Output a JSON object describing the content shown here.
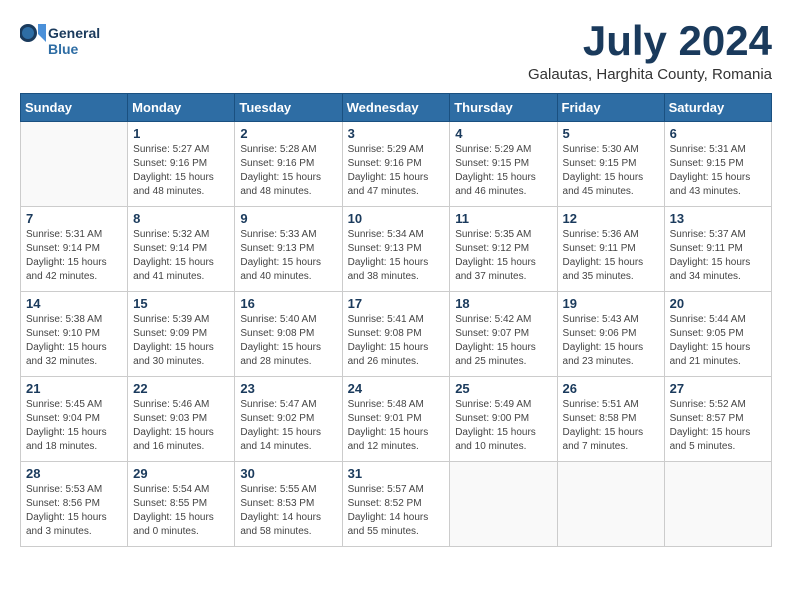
{
  "header": {
    "logo_line1": "General",
    "logo_line2": "Blue",
    "month_year": "July 2024",
    "location": "Galautas, Harghita County, Romania"
  },
  "days_of_week": [
    "Sunday",
    "Monday",
    "Tuesday",
    "Wednesday",
    "Thursday",
    "Friday",
    "Saturday"
  ],
  "weeks": [
    [
      {
        "day": "",
        "info": ""
      },
      {
        "day": "1",
        "info": "Sunrise: 5:27 AM\nSunset: 9:16 PM\nDaylight: 15 hours\nand 48 minutes."
      },
      {
        "day": "2",
        "info": "Sunrise: 5:28 AM\nSunset: 9:16 PM\nDaylight: 15 hours\nand 48 minutes."
      },
      {
        "day": "3",
        "info": "Sunrise: 5:29 AM\nSunset: 9:16 PM\nDaylight: 15 hours\nand 47 minutes."
      },
      {
        "day": "4",
        "info": "Sunrise: 5:29 AM\nSunset: 9:15 PM\nDaylight: 15 hours\nand 46 minutes."
      },
      {
        "day": "5",
        "info": "Sunrise: 5:30 AM\nSunset: 9:15 PM\nDaylight: 15 hours\nand 45 minutes."
      },
      {
        "day": "6",
        "info": "Sunrise: 5:31 AM\nSunset: 9:15 PM\nDaylight: 15 hours\nand 43 minutes."
      }
    ],
    [
      {
        "day": "7",
        "info": "Sunrise: 5:31 AM\nSunset: 9:14 PM\nDaylight: 15 hours\nand 42 minutes."
      },
      {
        "day": "8",
        "info": "Sunrise: 5:32 AM\nSunset: 9:14 PM\nDaylight: 15 hours\nand 41 minutes."
      },
      {
        "day": "9",
        "info": "Sunrise: 5:33 AM\nSunset: 9:13 PM\nDaylight: 15 hours\nand 40 minutes."
      },
      {
        "day": "10",
        "info": "Sunrise: 5:34 AM\nSunset: 9:13 PM\nDaylight: 15 hours\nand 38 minutes."
      },
      {
        "day": "11",
        "info": "Sunrise: 5:35 AM\nSunset: 9:12 PM\nDaylight: 15 hours\nand 37 minutes."
      },
      {
        "day": "12",
        "info": "Sunrise: 5:36 AM\nSunset: 9:11 PM\nDaylight: 15 hours\nand 35 minutes."
      },
      {
        "day": "13",
        "info": "Sunrise: 5:37 AM\nSunset: 9:11 PM\nDaylight: 15 hours\nand 34 minutes."
      }
    ],
    [
      {
        "day": "14",
        "info": "Sunrise: 5:38 AM\nSunset: 9:10 PM\nDaylight: 15 hours\nand 32 minutes."
      },
      {
        "day": "15",
        "info": "Sunrise: 5:39 AM\nSunset: 9:09 PM\nDaylight: 15 hours\nand 30 minutes."
      },
      {
        "day": "16",
        "info": "Sunrise: 5:40 AM\nSunset: 9:08 PM\nDaylight: 15 hours\nand 28 minutes."
      },
      {
        "day": "17",
        "info": "Sunrise: 5:41 AM\nSunset: 9:08 PM\nDaylight: 15 hours\nand 26 minutes."
      },
      {
        "day": "18",
        "info": "Sunrise: 5:42 AM\nSunset: 9:07 PM\nDaylight: 15 hours\nand 25 minutes."
      },
      {
        "day": "19",
        "info": "Sunrise: 5:43 AM\nSunset: 9:06 PM\nDaylight: 15 hours\nand 23 minutes."
      },
      {
        "day": "20",
        "info": "Sunrise: 5:44 AM\nSunset: 9:05 PM\nDaylight: 15 hours\nand 21 minutes."
      }
    ],
    [
      {
        "day": "21",
        "info": "Sunrise: 5:45 AM\nSunset: 9:04 PM\nDaylight: 15 hours\nand 18 minutes."
      },
      {
        "day": "22",
        "info": "Sunrise: 5:46 AM\nSunset: 9:03 PM\nDaylight: 15 hours\nand 16 minutes."
      },
      {
        "day": "23",
        "info": "Sunrise: 5:47 AM\nSunset: 9:02 PM\nDaylight: 15 hours\nand 14 minutes."
      },
      {
        "day": "24",
        "info": "Sunrise: 5:48 AM\nSunset: 9:01 PM\nDaylight: 15 hours\nand 12 minutes."
      },
      {
        "day": "25",
        "info": "Sunrise: 5:49 AM\nSunset: 9:00 PM\nDaylight: 15 hours\nand 10 minutes."
      },
      {
        "day": "26",
        "info": "Sunrise: 5:51 AM\nSunset: 8:58 PM\nDaylight: 15 hours\nand 7 minutes."
      },
      {
        "day": "27",
        "info": "Sunrise: 5:52 AM\nSunset: 8:57 PM\nDaylight: 15 hours\nand 5 minutes."
      }
    ],
    [
      {
        "day": "28",
        "info": "Sunrise: 5:53 AM\nSunset: 8:56 PM\nDaylight: 15 hours\nand 3 minutes."
      },
      {
        "day": "29",
        "info": "Sunrise: 5:54 AM\nSunset: 8:55 PM\nDaylight: 15 hours\nand 0 minutes."
      },
      {
        "day": "30",
        "info": "Sunrise: 5:55 AM\nSunset: 8:53 PM\nDaylight: 14 hours\nand 58 minutes."
      },
      {
        "day": "31",
        "info": "Sunrise: 5:57 AM\nSunset: 8:52 PM\nDaylight: 14 hours\nand 55 minutes."
      },
      {
        "day": "",
        "info": ""
      },
      {
        "day": "",
        "info": ""
      },
      {
        "day": "",
        "info": ""
      }
    ]
  ]
}
